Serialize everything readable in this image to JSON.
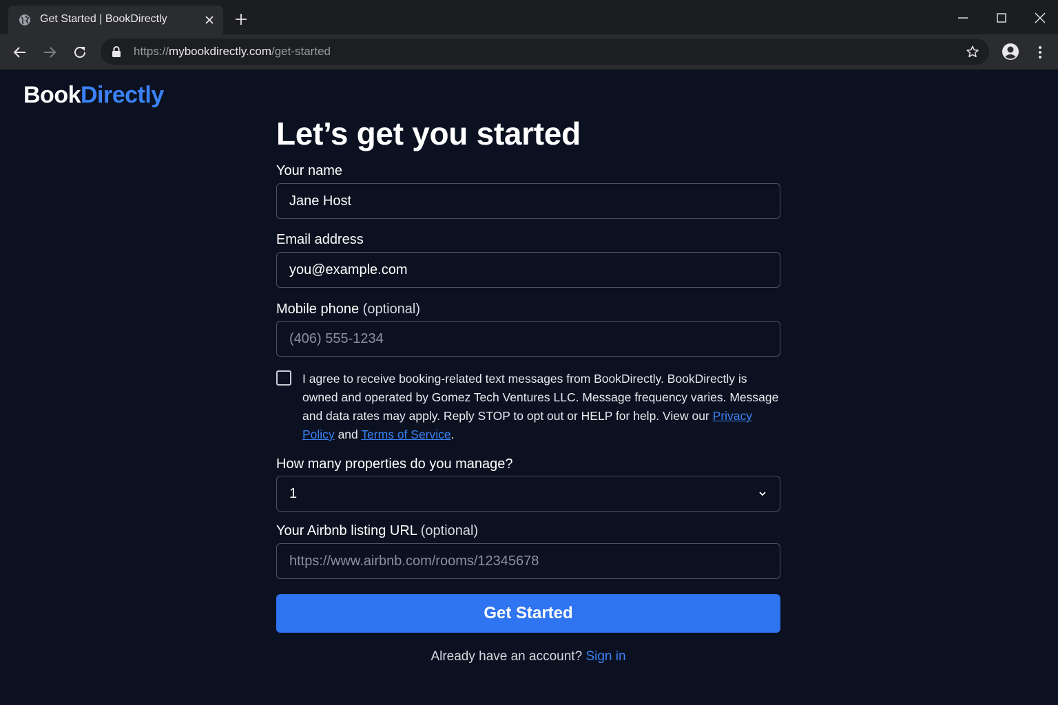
{
  "browser": {
    "tab_title": "Get Started | BookDirectly",
    "url_scheme": "https://",
    "url_host": "mybookdirectly.com",
    "url_path": "/get-started"
  },
  "logo": {
    "part1": "Book",
    "part2": "Directly"
  },
  "form": {
    "title": "Let’s get you started",
    "name": {
      "label": "Your name",
      "value": "Jane Host"
    },
    "email": {
      "label": "Email address",
      "value": "you@example.com"
    },
    "phone": {
      "label": "Mobile phone",
      "optional": "(optional)",
      "placeholder": "(406) 555-1234"
    },
    "consent": {
      "checked": false,
      "text": "I agree to receive booking-related text messages from BookDirectly. BookDirectly is owned and operated by Gomez Tech Ventures LLC. Message frequency varies. Message and data rates may apply. Reply STOP to opt out or HELP for help. View our",
      "privacy_link": "Privacy Policy",
      "and": "and",
      "terms_link": "Terms of Service",
      "end": "."
    },
    "properties": {
      "label": "How many properties do you manage?",
      "selected": "1"
    },
    "airbnb": {
      "label": "Your Airbnb listing URL",
      "optional": "(optional)",
      "placeholder": "https://www.airbnb.com/rooms/12345678"
    },
    "submit_label": "Get Started",
    "signin_prompt": "Already have an account?",
    "signin_link": "Sign in"
  },
  "colors": {
    "accent": "#2f74f0",
    "link": "#3b82f6",
    "background": "#0b1120"
  }
}
